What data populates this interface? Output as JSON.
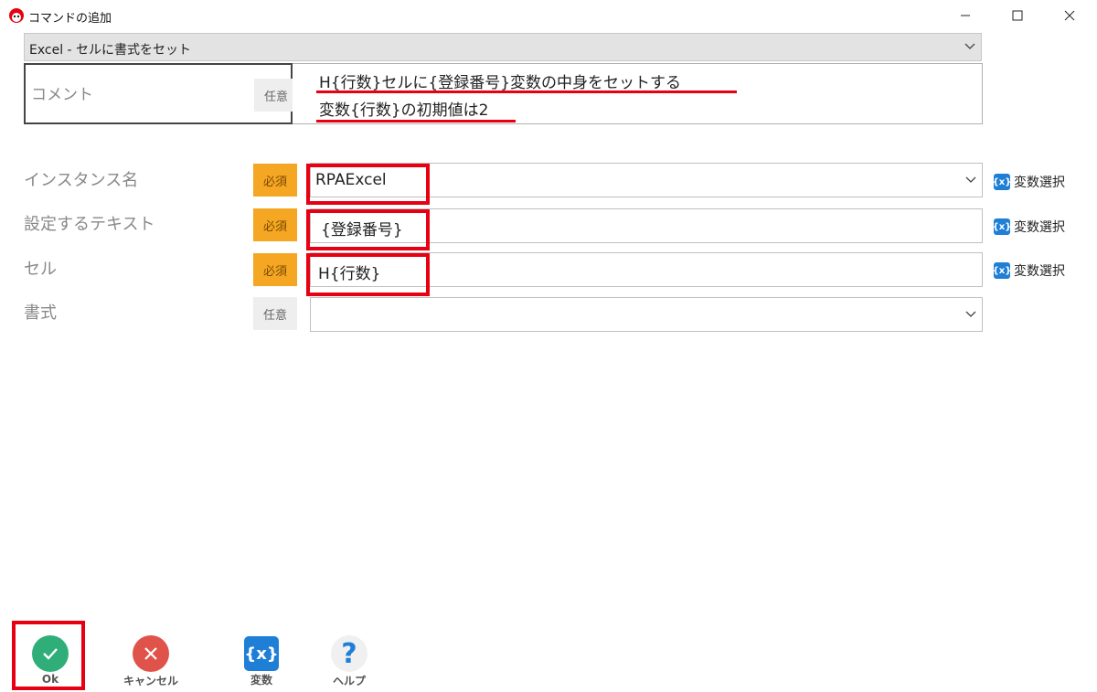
{
  "window": {
    "title": "コマンドの追加",
    "minimize_icon": "minimize-icon",
    "maximize_icon": "maximize-icon",
    "close_icon": "close-icon"
  },
  "command_select": {
    "value": "Excel - セルに書式をセット"
  },
  "comment": {
    "label": "コメント",
    "badge": "任意",
    "line1": "H{行数}セルに{登録番号}変数の中身をセットする",
    "line2": "変数{行数}の初期値は2"
  },
  "form": {
    "rows": [
      {
        "label": "インスタンス名",
        "badge": "必須",
        "value": "RPAExcel",
        "var_select": "変数選択"
      },
      {
        "label": "設定するテキスト",
        "badge": "必須",
        "value": "{登録番号}",
        "var_select": "変数選択"
      },
      {
        "label": "セル",
        "badge": "必須",
        "value": "H{行数}",
        "var_select": "変数選択"
      },
      {
        "label": "書式",
        "badge": "任意",
        "value": ""
      }
    ]
  },
  "buttons": {
    "ok": "Ok",
    "cancel": "キャンセル",
    "variables": "変数",
    "help": "ヘルプ"
  },
  "icons": {
    "var_icon_text": "{x}",
    "help_glyph": "?"
  },
  "colors": {
    "required_badge": "#f5a623",
    "optional_badge": "#eeeeee",
    "highlight_red": "#e60012",
    "ok_green": "#2fae7a",
    "cancel_red": "#e0534a",
    "variable_blue": "#1f7fd6"
  }
}
